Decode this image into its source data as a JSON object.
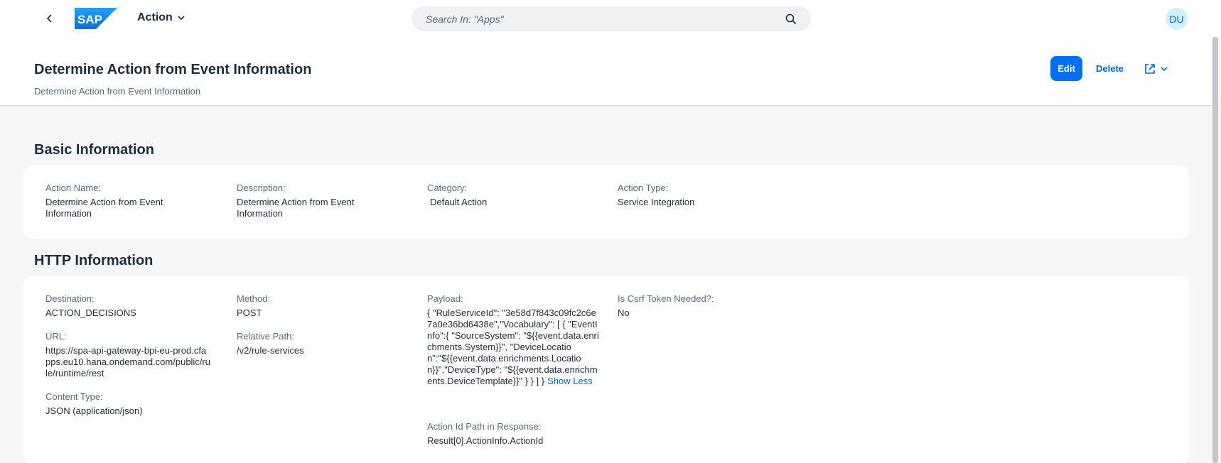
{
  "shell": {
    "app_title": "Action",
    "search_placeholder": "Search In: \"Apps\"",
    "avatar_initials": "DU",
    "logo_text": "SAP"
  },
  "header": {
    "title": "Determine Action from Event Information",
    "subtitle": "Determine Action from Event Information",
    "edit_label": "Edit",
    "delete_label": "Delete"
  },
  "basic_info": {
    "section_title": "Basic Information",
    "action_name_label": "Action Name:",
    "action_name": "Determine Action from Event Information",
    "description_label": "Description:",
    "description": "Determine Action from Event Information",
    "category_label": "Category:",
    "category": "Default Action",
    "action_type_label": "Action Type:",
    "action_type": "Service Integration"
  },
  "http_info": {
    "section_title": "HTTP Information",
    "destination_label": "Destination:",
    "destination": "ACTION_DECISIONS",
    "url_label": "URL:",
    "url": "https://spa-api-gateway-bpi-eu-prod.cfapps.eu10.hana.ondemand.com/public/rule/runtime/rest",
    "content_type_label": "Content Type:",
    "content_type": "JSON (application/json)",
    "method_label": "Method:",
    "method": "POST",
    "relative_path_label": "Relative Path:",
    "relative_path": "/v2/rule-services",
    "payload_label": "Payload:",
    "payload": "{ \"RuleServiceId\": \"3e58d7f843c09fc2c6e7a0e36bd6438e\",\"Vocabulary\": [ { \"EventInfo\":{ \"SourceSystem\": \"${{event.data.enrichments.System}}\", \"DeviceLocation\":\"${{event.data.enrichments.Location}}\",\"DeviceType\": \"${{event.data.enrichments.DeviceTemplate}}\" } } ] }",
    "show_less_label": "Show Less",
    "action_id_path_label": "Action Id Path in Response:",
    "action_id_path": "Result[0].ActionInfo.ActionId",
    "csrf_label": "Is Csrf Token Needed?:",
    "csrf": "No"
  },
  "colors": {
    "brand_blue": "#0070f2",
    "link_blue": "#0064d9",
    "page_bg": "#f5f6f7",
    "text": "#1d2d3e",
    "label": "#556b82"
  },
  "icons": [
    "back-icon",
    "chevron-down-icon",
    "search-icon",
    "share-icon"
  ]
}
